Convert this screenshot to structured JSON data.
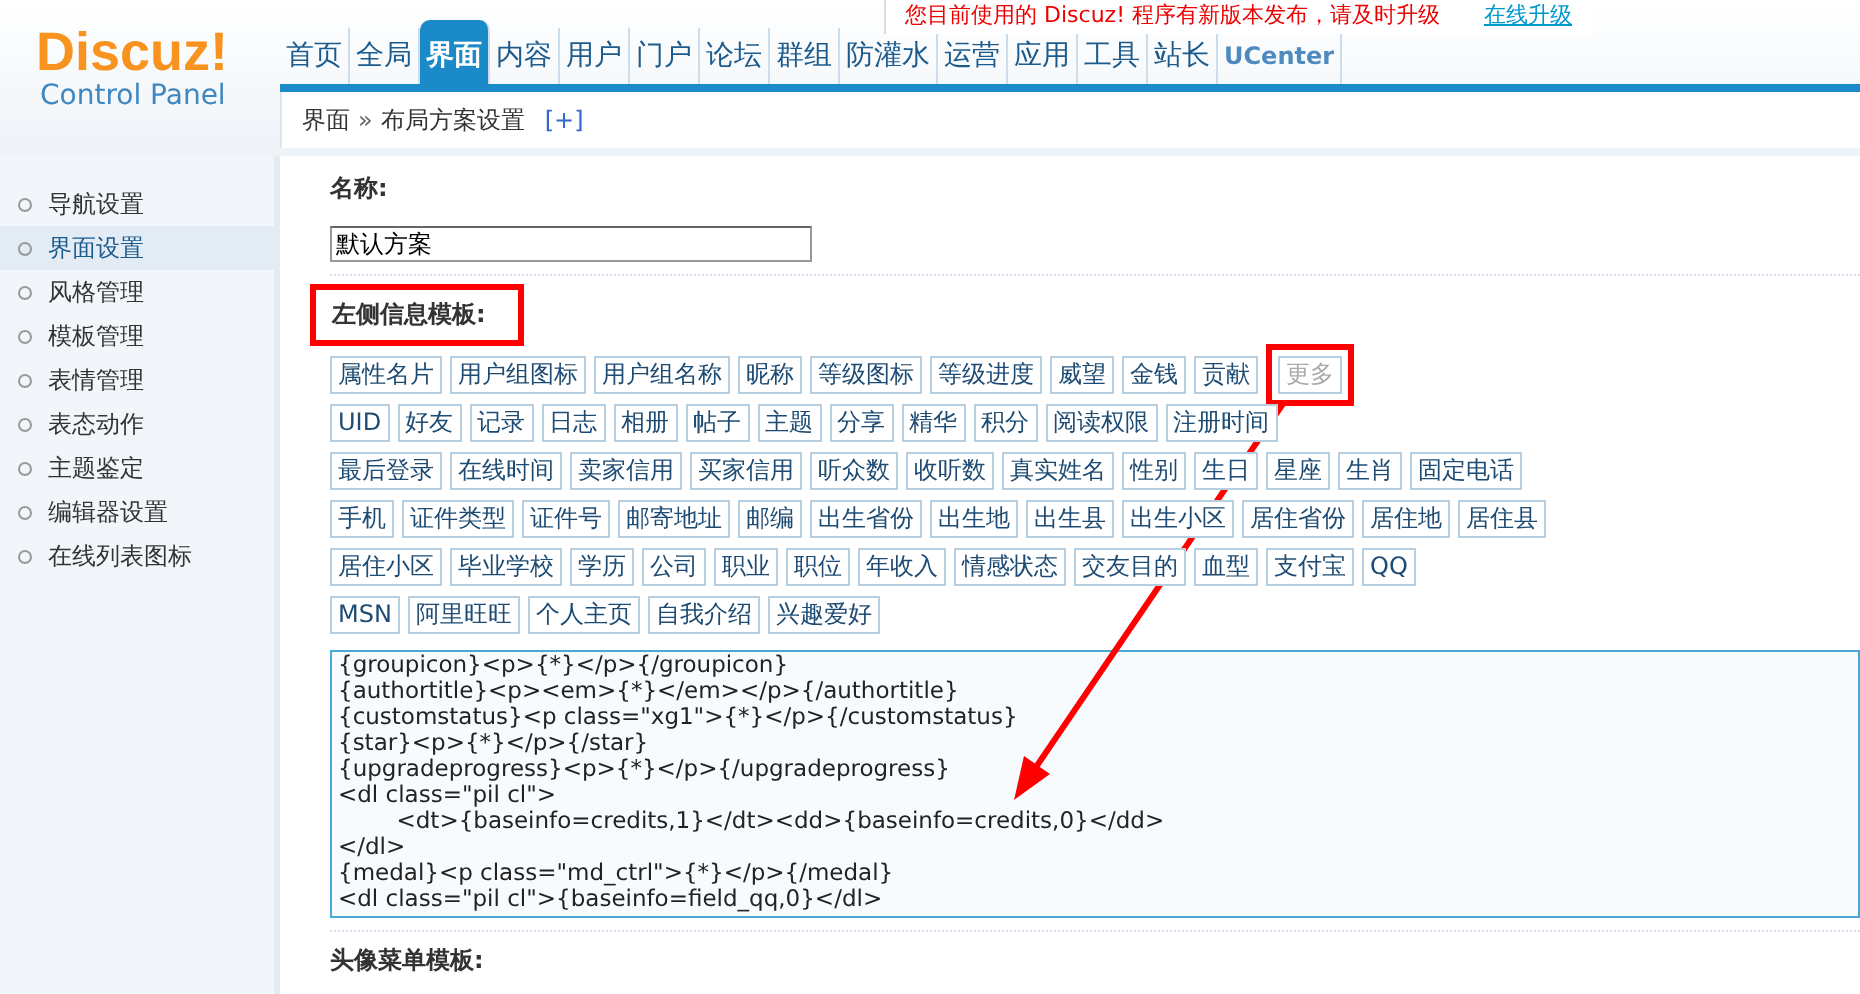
{
  "logo": {
    "title": "Discuz!",
    "subtitle": "Control Panel"
  },
  "nav": [
    {
      "label": "首页",
      "selected": false
    },
    {
      "label": "全局",
      "selected": false
    },
    {
      "label": "界面",
      "selected": true
    },
    {
      "label": "内容",
      "selected": false
    },
    {
      "label": "用户",
      "selected": false
    },
    {
      "label": "门户",
      "selected": false
    },
    {
      "label": "论坛",
      "selected": false
    },
    {
      "label": "群组",
      "selected": false
    },
    {
      "label": "防灌水",
      "selected": false
    },
    {
      "label": "运营",
      "selected": false
    },
    {
      "label": "应用",
      "selected": false
    },
    {
      "label": "工具",
      "selected": false
    },
    {
      "label": "站长",
      "selected": false
    },
    {
      "label": "UCenter",
      "selected": false
    }
  ],
  "notice": {
    "text": "您目前使用的 Discuz! 程序有新版本发布，请及时升级",
    "link": "在线升级"
  },
  "breadcrumb": {
    "items": [
      "界面",
      "布局方案设置"
    ],
    "separator": "»",
    "add": "[+]"
  },
  "sidebar": [
    {
      "label": "导航设置",
      "selected": false
    },
    {
      "label": "界面设置",
      "selected": true
    },
    {
      "label": "风格管理",
      "selected": false
    },
    {
      "label": "模板管理",
      "selected": false
    },
    {
      "label": "表情管理",
      "selected": false
    },
    {
      "label": "表态动作",
      "selected": false
    },
    {
      "label": "主题鉴定",
      "selected": false
    },
    {
      "label": "编辑器设置",
      "selected": false
    },
    {
      "label": "在线列表图标",
      "selected": false
    }
  ],
  "name_field": {
    "label": "名称:",
    "value": "默认方案"
  },
  "left_template": {
    "label": "左侧信息模板:",
    "highlighted": true,
    "tag_rows": [
      [
        {
          "label": "属性名片",
          "disabled": false,
          "highlighted": false
        },
        {
          "label": "用户组图标",
          "disabled": false,
          "highlighted": false
        },
        {
          "label": "用户组名称",
          "disabled": false,
          "highlighted": false
        },
        {
          "label": "昵称",
          "disabled": false,
          "highlighted": false
        },
        {
          "label": "等级图标",
          "disabled": false,
          "highlighted": false
        },
        {
          "label": "等级进度",
          "disabled": false,
          "highlighted": false
        },
        {
          "label": "威望",
          "disabled": false,
          "highlighted": false
        },
        {
          "label": "金钱",
          "disabled": false,
          "highlighted": false
        },
        {
          "label": "贡献",
          "disabled": false,
          "highlighted": false
        },
        {
          "label": "更多",
          "disabled": true,
          "highlighted": true
        }
      ],
      [
        {
          "label": "UID",
          "disabled": false,
          "highlighted": false
        },
        {
          "label": "好友",
          "disabled": false,
          "highlighted": false
        },
        {
          "label": "记录",
          "disabled": false,
          "highlighted": false
        },
        {
          "label": "日志",
          "disabled": false,
          "highlighted": false
        },
        {
          "label": "相册",
          "disabled": false,
          "highlighted": false
        },
        {
          "label": "帖子",
          "disabled": false,
          "highlighted": false
        },
        {
          "label": "主题",
          "disabled": false,
          "highlighted": false
        },
        {
          "label": "分享",
          "disabled": false,
          "highlighted": false
        },
        {
          "label": "精华",
          "disabled": false,
          "highlighted": false
        },
        {
          "label": "积分",
          "disabled": false,
          "highlighted": false
        },
        {
          "label": "阅读权限",
          "disabled": false,
          "highlighted": false
        },
        {
          "label": "注册时间",
          "disabled": false,
          "highlighted": false
        }
      ],
      [
        {
          "label": "最后登录",
          "disabled": false,
          "highlighted": false
        },
        {
          "label": "在线时间",
          "disabled": false,
          "highlighted": false
        },
        {
          "label": "卖家信用",
          "disabled": false,
          "highlighted": false
        },
        {
          "label": "买家信用",
          "disabled": false,
          "highlighted": false
        },
        {
          "label": "听众数",
          "disabled": false,
          "highlighted": false
        },
        {
          "label": "收听数",
          "disabled": false,
          "highlighted": false
        },
        {
          "label": "真实姓名",
          "disabled": false,
          "highlighted": false
        },
        {
          "label": "性别",
          "disabled": false,
          "highlighted": false
        },
        {
          "label": "生日",
          "disabled": false,
          "highlighted": false
        },
        {
          "label": "星座",
          "disabled": false,
          "highlighted": false
        },
        {
          "label": "生肖",
          "disabled": false,
          "highlighted": false
        },
        {
          "label": "固定电话",
          "disabled": false,
          "highlighted": false
        }
      ],
      [
        {
          "label": "手机",
          "disabled": false,
          "highlighted": false
        },
        {
          "label": "证件类型",
          "disabled": false,
          "highlighted": false
        },
        {
          "label": "证件号",
          "disabled": false,
          "highlighted": false
        },
        {
          "label": "邮寄地址",
          "disabled": false,
          "highlighted": false
        },
        {
          "label": "邮编",
          "disabled": false,
          "highlighted": false
        },
        {
          "label": "出生省份",
          "disabled": false,
          "highlighted": false
        },
        {
          "label": "出生地",
          "disabled": false,
          "highlighted": false
        },
        {
          "label": "出生县",
          "disabled": false,
          "highlighted": false
        },
        {
          "label": "出生小区",
          "disabled": false,
          "highlighted": false
        },
        {
          "label": "居住省份",
          "disabled": false,
          "highlighted": false
        },
        {
          "label": "居住地",
          "disabled": false,
          "highlighted": false
        },
        {
          "label": "居住县",
          "disabled": false,
          "highlighted": false
        }
      ],
      [
        {
          "label": "居住小区",
          "disabled": false,
          "highlighted": false
        },
        {
          "label": "毕业学校",
          "disabled": false,
          "highlighted": false
        },
        {
          "label": "学历",
          "disabled": false,
          "highlighted": false
        },
        {
          "label": "公司",
          "disabled": false,
          "highlighted": false
        },
        {
          "label": "职业",
          "disabled": false,
          "highlighted": false
        },
        {
          "label": "职位",
          "disabled": false,
          "highlighted": false
        },
        {
          "label": "年收入",
          "disabled": false,
          "highlighted": false
        },
        {
          "label": "情感状态",
          "disabled": false,
          "highlighted": false
        },
        {
          "label": "交友目的",
          "disabled": false,
          "highlighted": false
        },
        {
          "label": "血型",
          "disabled": false,
          "highlighted": false
        },
        {
          "label": "支付宝",
          "disabled": false,
          "highlighted": false
        },
        {
          "label": "QQ",
          "disabled": false,
          "highlighted": false
        }
      ],
      [
        {
          "label": "MSN",
          "disabled": false,
          "highlighted": false
        },
        {
          "label": "阿里旺旺",
          "disabled": false,
          "highlighted": false
        },
        {
          "label": "个人主页",
          "disabled": false,
          "highlighted": false
        },
        {
          "label": "自我介绍",
          "disabled": false,
          "highlighted": false
        },
        {
          "label": "兴趣爱好",
          "disabled": false,
          "highlighted": false
        }
      ]
    ],
    "code_lines": [
      "{groupicon}<p>{*}</p>{/groupicon}",
      "{authortitle}<p><em>{*}</em></p>{/authortitle}",
      "{customstatus}<p class=\"xg1\">{*}</p>{/customstatus}",
      "{star}<p>{*}</p>{/star}",
      "{upgradeprogress}<p>{*}</p>{/upgradeprogress}",
      "<dl class=\"pil cl\">",
      "\t<dt>{baseinfo=credits,1}</dt><dd>{baseinfo=credits,0}</dd>",
      "</dl>",
      "{medal}<p class=\"md_ctrl\">{*}</p>{/medal}",
      "<dl class=\"pil cl\">{baseinfo=field_qq,0}</dl>"
    ]
  },
  "next_section": {
    "label": "头像菜单模板:"
  }
}
